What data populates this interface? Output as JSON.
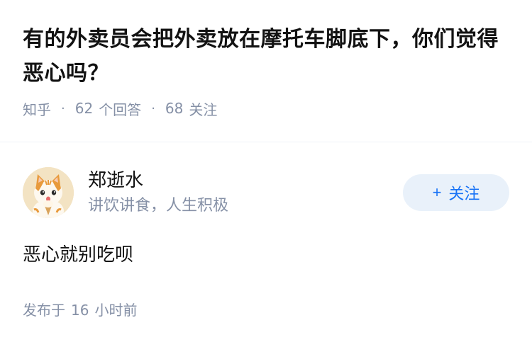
{
  "question": {
    "title": "有的外卖员会把外卖放在摩托车脚底下，你们觉得恶心吗？",
    "source": "知乎",
    "separator": "·",
    "answers_count": "62",
    "answers_label": "个回答",
    "follows_count": "68",
    "follows_label": "关注"
  },
  "answer": {
    "author": {
      "name": "郑逝水",
      "bio": "讲饮讲食，人生积极",
      "avatar_icon": "cat-avatar"
    },
    "follow_button": {
      "plus": "+",
      "label": "关注"
    },
    "text": "恶心就别吃呗",
    "time_prefix": "发布于",
    "time_value": "16",
    "time_suffix": "小时前"
  },
  "colors": {
    "primary_text": "#121212",
    "secondary_text": "#8590a6",
    "accent": "#1772f6",
    "follow_bg": "#e9f1fa"
  }
}
